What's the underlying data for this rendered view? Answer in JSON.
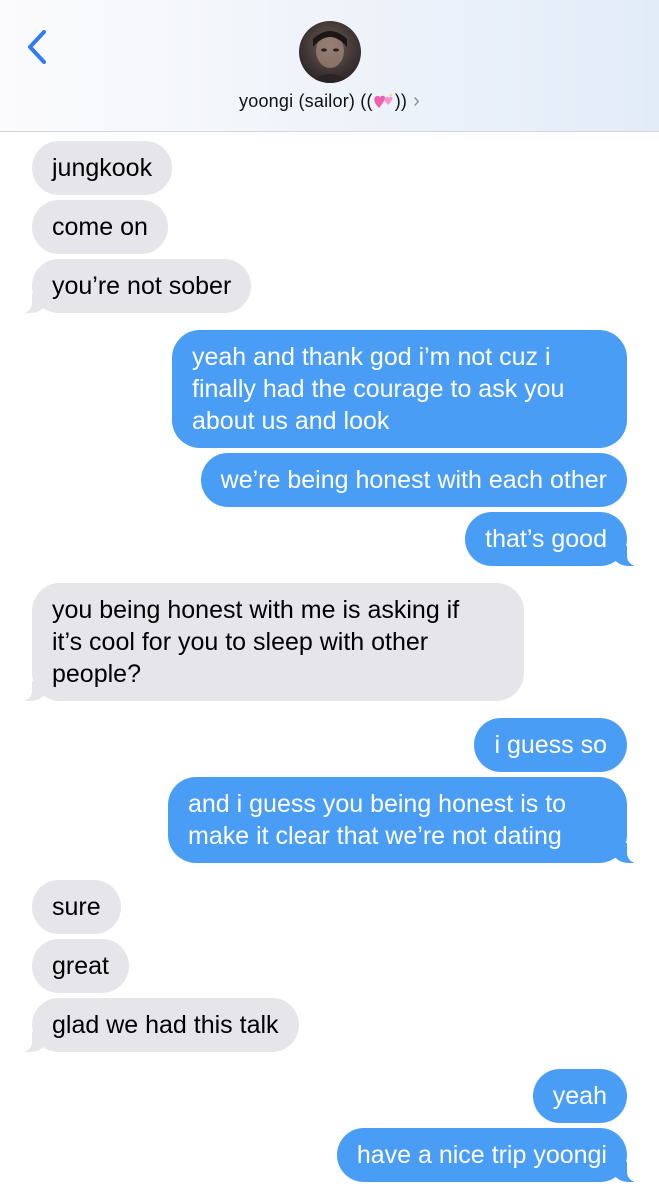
{
  "header": {
    "back_icon": "chevron-left-icon",
    "contact_name_prefix": "yoongi (sailor) ((",
    "contact_name_suffix": "))",
    "emoji": "two-hearts-emoji",
    "disclosure_icon": "chevron-right-icon",
    "disclosure_glyph": "›",
    "accent_color": "#2f7cf6"
  },
  "messages": [
    {
      "from": "them",
      "text": "jungkook"
    },
    {
      "from": "them",
      "text": "come on"
    },
    {
      "from": "them",
      "text": "you’re not sober"
    },
    {
      "from": "me",
      "text": "yeah and thank god i’m not cuz i\nfinally had the courage to ask you\nabout us and look"
    },
    {
      "from": "me",
      "text": "we’re being honest with each other"
    },
    {
      "from": "me",
      "text": "that’s good"
    },
    {
      "from": "them",
      "text": "you being honest with me is asking if\nit’s cool for you to sleep with other\npeople?"
    },
    {
      "from": "me",
      "text": "i guess so"
    },
    {
      "from": "me",
      "text": "and i guess you being honest is to\nmake it clear that we’re not dating"
    },
    {
      "from": "them",
      "text": "sure"
    },
    {
      "from": "them",
      "text": "great"
    },
    {
      "from": "them",
      "text": "glad we had this talk"
    },
    {
      "from": "me",
      "text": "yeah"
    },
    {
      "from": "me",
      "text": "have a nice trip yoongi"
    }
  ],
  "colors": {
    "incoming_bubble": "#e5e5ea",
    "outgoing_bubble": "#4a9df5",
    "outgoing_text": "#ffffff"
  }
}
